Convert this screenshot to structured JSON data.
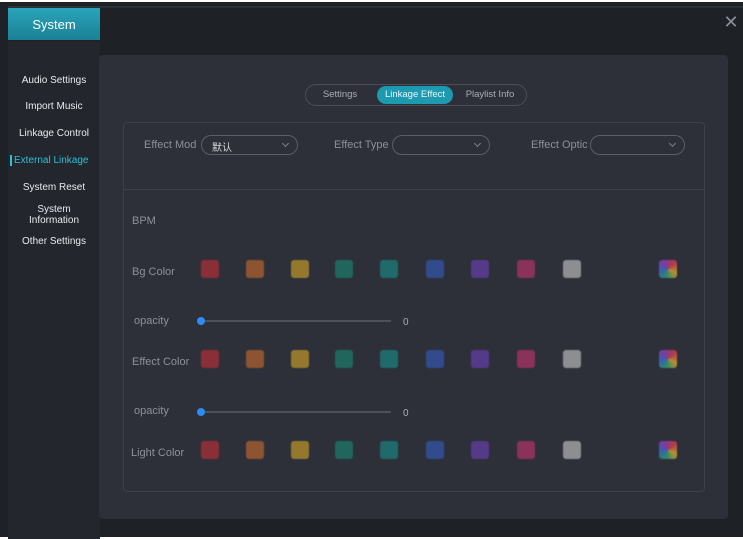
{
  "window": {
    "title": "System",
    "close_glyph": "✕"
  },
  "sidebar": {
    "items": [
      {
        "label": "Audio Settings"
      },
      {
        "label": "Import Music"
      },
      {
        "label": "Linkage Control"
      },
      {
        "label": "External Linkage"
      },
      {
        "label": "System Reset"
      },
      {
        "label": "System Information"
      },
      {
        "label": "Other Settings"
      }
    ]
  },
  "tabs": {
    "settings": "Settings",
    "linkage_effect": "Linkage Effect",
    "playlist_info": "Playlist Info",
    "active": "linkage_effect"
  },
  "effect": {
    "mode_label": "Effect Mod",
    "mode_value": "默认",
    "type_label": "Effect Type",
    "type_value": "",
    "option_label": "Effect Optic",
    "option_value": ""
  },
  "bpm_label": "BPM",
  "bg_color": {
    "label": "Bg Color"
  },
  "bg_opacity": {
    "label": "opacity",
    "value": "0",
    "fraction": 0
  },
  "effect_color": {
    "label": "Effect Color"
  },
  "effect_opacity": {
    "label": "opacity",
    "value": "0",
    "fraction": 0
  },
  "light_color": {
    "label": "Light Color"
  },
  "palette": [
    "#8a2f38",
    "#8c5431",
    "#93782e",
    "#21665d",
    "#1f6b6b",
    "#314b8c",
    "#553a8a",
    "#8a3259",
    "#8c8e92"
  ],
  "accent": "#1d9ab0",
  "custom_swatch_icon": "color-gradient-icon"
}
